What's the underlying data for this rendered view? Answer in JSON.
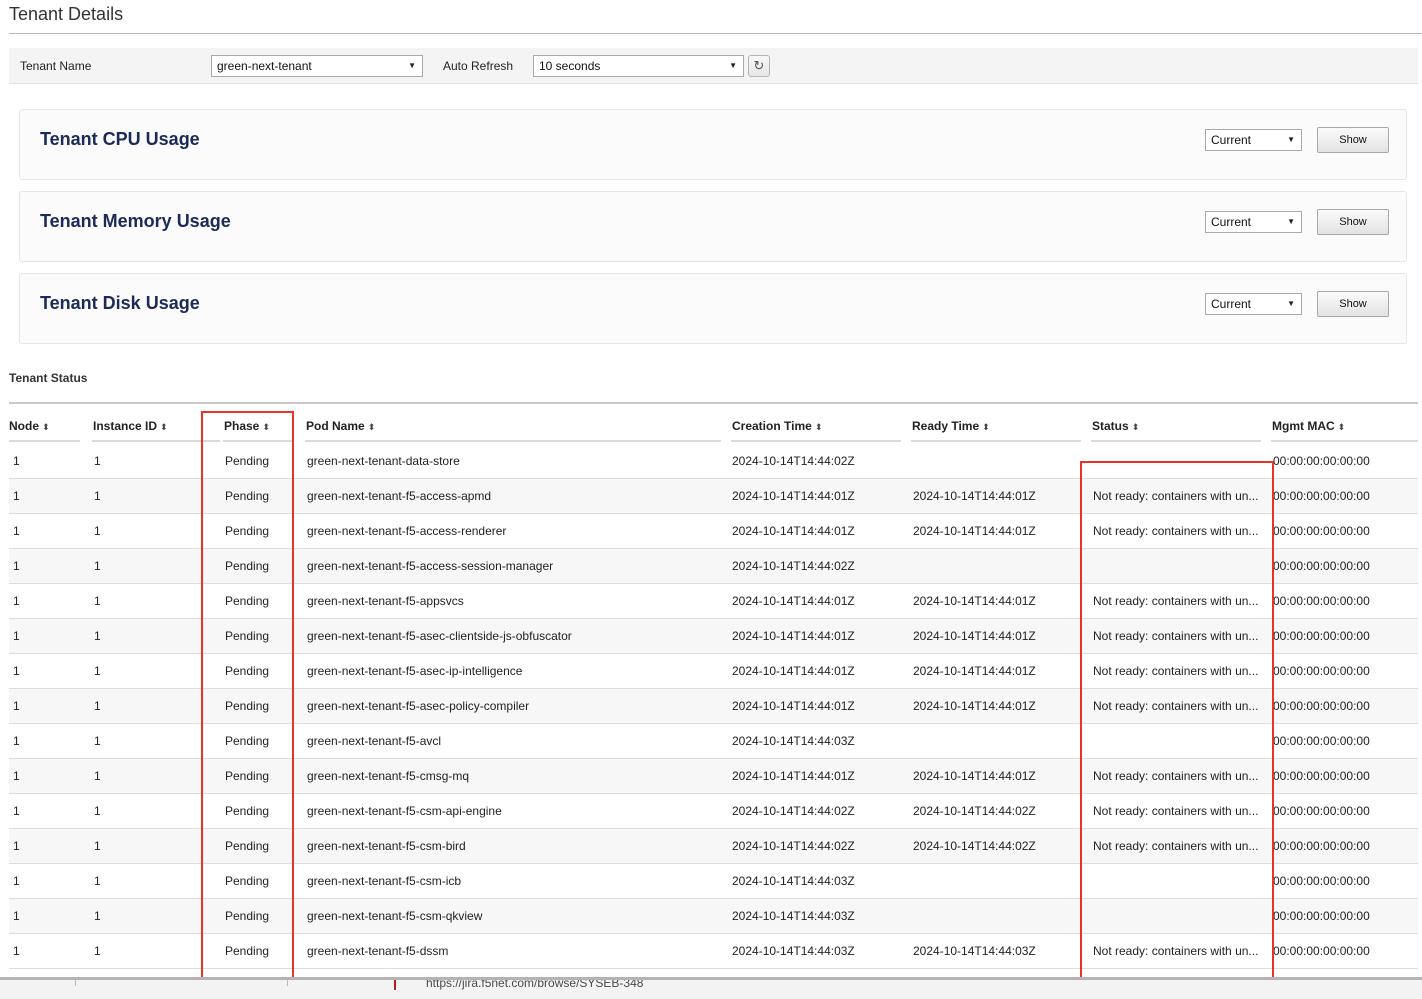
{
  "page": {
    "title": "Tenant Details"
  },
  "filters": {
    "tenant_label": "Tenant Name",
    "tenant_value": "green-next-tenant",
    "refresh_label": "Auto Refresh",
    "refresh_value": "10 seconds",
    "refresh_icon": "refresh-icon"
  },
  "panels": [
    {
      "title": "Tenant CPU Usage",
      "range": "Current",
      "button": "Show"
    },
    {
      "title": "Tenant Memory Usage",
      "range": "Current",
      "button": "Show"
    },
    {
      "title": "Tenant Disk Usage",
      "range": "Current",
      "button": "Show"
    }
  ],
  "status_section": {
    "title": "Tenant Status",
    "columns": [
      "Node",
      "Instance ID",
      "Phase",
      "Pod Name",
      "Creation Time",
      "Ready Time",
      "Status",
      "Mgmt MAC"
    ],
    "sort_icon": "sort-icon",
    "rows": [
      {
        "node": "1",
        "instance": "1",
        "phase": "Pending",
        "pod": "green-next-tenant-data-store",
        "created": "2024-10-14T14:44:02Z",
        "ready": "",
        "status": "",
        "mac": "00:00:00:00:00:00"
      },
      {
        "node": "1",
        "instance": "1",
        "phase": "Pending",
        "pod": "green-next-tenant-f5-access-apmd",
        "created": "2024-10-14T14:44:01Z",
        "ready": "2024-10-14T14:44:01Z",
        "status": "Not ready: containers with un...",
        "mac": "00:00:00:00:00:00"
      },
      {
        "node": "1",
        "instance": "1",
        "phase": "Pending",
        "pod": "green-next-tenant-f5-access-renderer",
        "created": "2024-10-14T14:44:01Z",
        "ready": "2024-10-14T14:44:01Z",
        "status": "Not ready: containers with un...",
        "mac": "00:00:00:00:00:00"
      },
      {
        "node": "1",
        "instance": "1",
        "phase": "Pending",
        "pod": "green-next-tenant-f5-access-session-manager",
        "created": "2024-10-14T14:44:02Z",
        "ready": "",
        "status": "",
        "mac": "00:00:00:00:00:00"
      },
      {
        "node": "1",
        "instance": "1",
        "phase": "Pending",
        "pod": "green-next-tenant-f5-appsvcs",
        "created": "2024-10-14T14:44:01Z",
        "ready": "2024-10-14T14:44:01Z",
        "status": "Not ready: containers with un...",
        "mac": "00:00:00:00:00:00"
      },
      {
        "node": "1",
        "instance": "1",
        "phase": "Pending",
        "pod": "green-next-tenant-f5-asec-clientside-js-obfuscator",
        "created": "2024-10-14T14:44:01Z",
        "ready": "2024-10-14T14:44:01Z",
        "status": "Not ready: containers with un...",
        "mac": "00:00:00:00:00:00"
      },
      {
        "node": "1",
        "instance": "1",
        "phase": "Pending",
        "pod": "green-next-tenant-f5-asec-ip-intelligence",
        "created": "2024-10-14T14:44:01Z",
        "ready": "2024-10-14T14:44:01Z",
        "status": "Not ready: containers with un...",
        "mac": "00:00:00:00:00:00"
      },
      {
        "node": "1",
        "instance": "1",
        "phase": "Pending",
        "pod": "green-next-tenant-f5-asec-policy-compiler",
        "created": "2024-10-14T14:44:01Z",
        "ready": "2024-10-14T14:44:01Z",
        "status": "Not ready: containers with un...",
        "mac": "00:00:00:00:00:00"
      },
      {
        "node": "1",
        "instance": "1",
        "phase": "Pending",
        "pod": "green-next-tenant-f5-avcl",
        "created": "2024-10-14T14:44:03Z",
        "ready": "",
        "status": "",
        "mac": "00:00:00:00:00:00"
      },
      {
        "node": "1",
        "instance": "1",
        "phase": "Pending",
        "pod": "green-next-tenant-f5-cmsg-mq",
        "created": "2024-10-14T14:44:01Z",
        "ready": "2024-10-14T14:44:01Z",
        "status": "Not ready: containers with un...",
        "mac": "00:00:00:00:00:00"
      },
      {
        "node": "1",
        "instance": "1",
        "phase": "Pending",
        "pod": "green-next-tenant-f5-csm-api-engine",
        "created": "2024-10-14T14:44:02Z",
        "ready": "2024-10-14T14:44:02Z",
        "status": "Not ready: containers with un...",
        "mac": "00:00:00:00:00:00"
      },
      {
        "node": "1",
        "instance": "1",
        "phase": "Pending",
        "pod": "green-next-tenant-f5-csm-bird",
        "created": "2024-10-14T14:44:02Z",
        "ready": "2024-10-14T14:44:02Z",
        "status": "Not ready: containers with un...",
        "mac": "00:00:00:00:00:00"
      },
      {
        "node": "1",
        "instance": "1",
        "phase": "Pending",
        "pod": "green-next-tenant-f5-csm-icb",
        "created": "2024-10-14T14:44:03Z",
        "ready": "",
        "status": "",
        "mac": "00:00:00:00:00:00"
      },
      {
        "node": "1",
        "instance": "1",
        "phase": "Pending",
        "pod": "green-next-tenant-f5-csm-qkview",
        "created": "2024-10-14T14:44:03Z",
        "ready": "",
        "status": "",
        "mac": "00:00:00:00:00:00"
      },
      {
        "node": "1",
        "instance": "1",
        "phase": "Pending",
        "pod": "green-next-tenant-f5-dssm",
        "created": "2024-10-14T14:44:03Z",
        "ready": "2024-10-14T14:44:03Z",
        "status": "Not ready: containers with un...",
        "mac": "00:00:00:00:00:00"
      }
    ]
  },
  "footer": {
    "link_text": "https://jira.f5net.com/browse/SYSEB-348"
  },
  "colors": {
    "panel_title": "#1b2a56",
    "highlight": "#ea3323"
  }
}
